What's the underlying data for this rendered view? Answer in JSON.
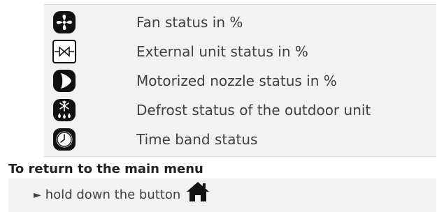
{
  "legend": {
    "rows": [
      {
        "icon": "fan-icon",
        "label": "Fan status in %"
      },
      {
        "icon": "valve-icon",
        "label": "External unit status in %"
      },
      {
        "icon": "nozzle-icon",
        "label": "Motorized nozzle status in %"
      },
      {
        "icon": "defrost-icon",
        "label": "Defrost status of the outdoor unit"
      },
      {
        "icon": "clock-icon",
        "label": "Time band status"
      }
    ]
  },
  "return_section": {
    "heading": "To return to the main menu",
    "arrow": "►",
    "instruction": "hold down the button",
    "button_icon": "home-icon"
  },
  "colors": {
    "panel_background": "#f2f2f2",
    "text": "#3f3f3f",
    "icon": "#111111"
  }
}
